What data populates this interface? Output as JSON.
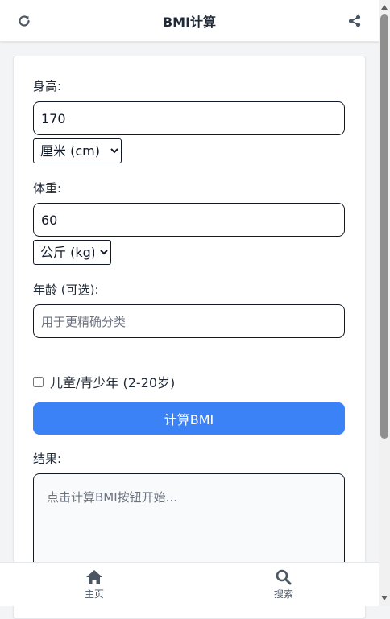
{
  "header": {
    "title": "BMI计算",
    "left_icon": "refresh-icon",
    "right_icon": "share-icon"
  },
  "form": {
    "height": {
      "label": "身高:",
      "value": "170",
      "unit_selected": "厘米 (cm)"
    },
    "weight": {
      "label": "体重:",
      "value": "60",
      "unit_selected": "公斤 (kg)"
    },
    "age": {
      "label": "年龄 (可选):",
      "value": "",
      "placeholder": "用于更精确分类"
    },
    "child_checkbox": {
      "label": "儿童/青少年 (2-20岁)",
      "checked": false
    },
    "calculate_button": "计算BMI"
  },
  "result": {
    "label": "结果:",
    "placeholder_text": "点击计算BMI按钮开始..."
  },
  "bottom_nav": {
    "items": [
      {
        "label": "主页",
        "icon": "home-icon"
      },
      {
        "label": "搜索",
        "icon": "search-icon"
      }
    ]
  },
  "colors": {
    "accent": "#3b82f6",
    "icon": "#4b5563",
    "text": "#1f2937"
  }
}
